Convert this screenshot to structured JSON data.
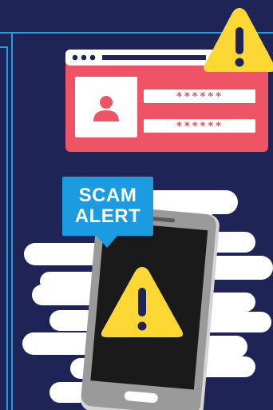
{
  "alert": {
    "title_line1": "SCAM",
    "title_line2": "ALERT"
  },
  "login_card": {
    "username_value": "******",
    "password_value": "******"
  },
  "icons": {
    "browser_warning": "warning-triangle-icon",
    "phone_warning": "warning-triangle-icon",
    "user": "user-icon"
  },
  "colors": {
    "background": "#1f2456",
    "card": "#ef5366",
    "alert_blue": "#1b9be0",
    "warning_yellow": "#fdd835",
    "phone_screen": "#1a1a1a"
  }
}
